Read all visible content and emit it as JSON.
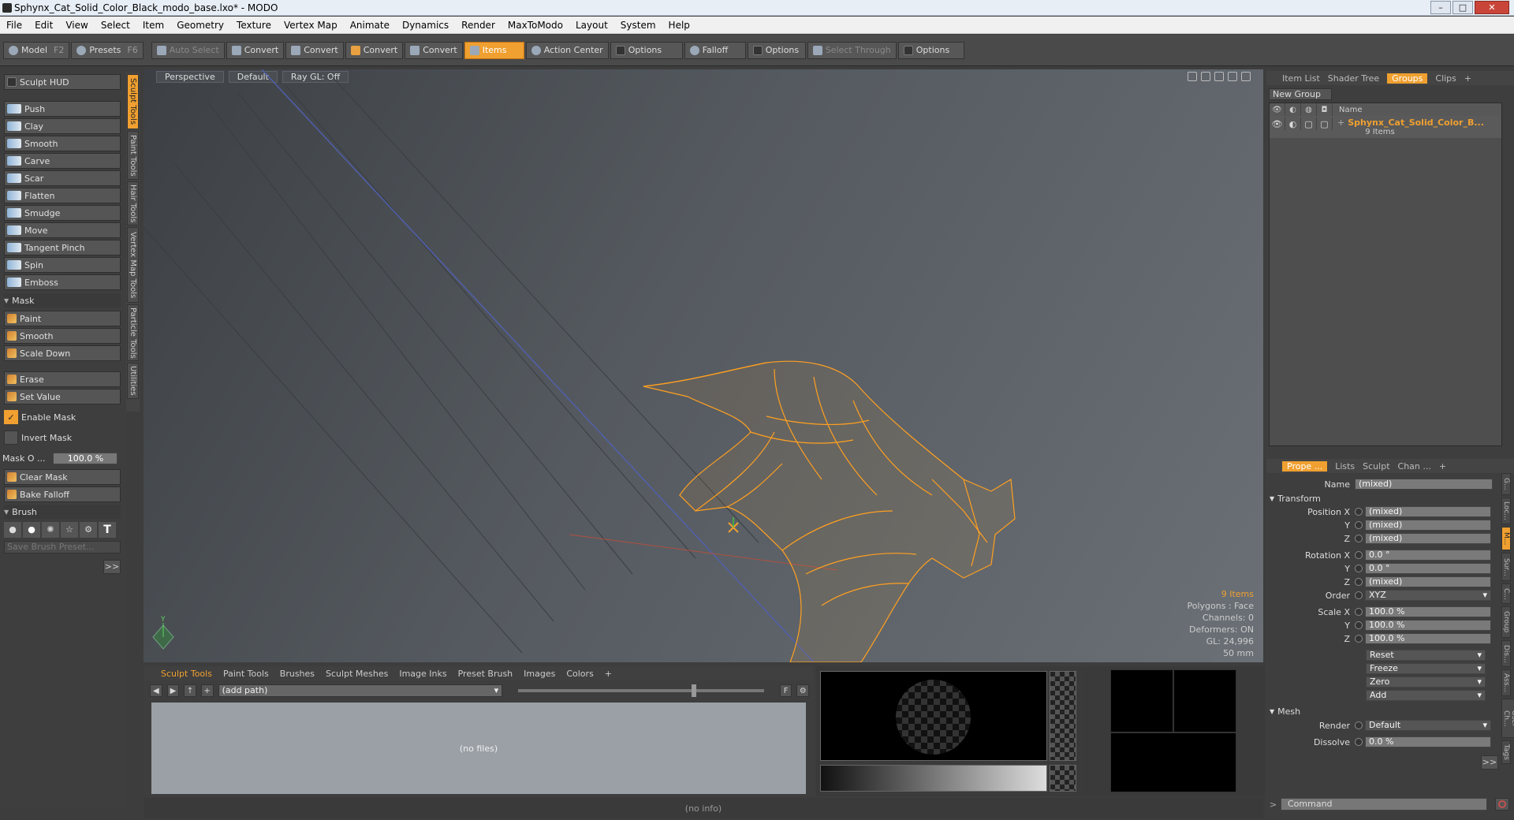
{
  "window": {
    "title": "Sphynx_Cat_Solid_Color_Black_modo_base.lxo* - MODO"
  },
  "menu": [
    "File",
    "Edit",
    "View",
    "Select",
    "Item",
    "Geometry",
    "Texture",
    "Vertex Map",
    "Animate",
    "Dynamics",
    "Render",
    "MaxToModo",
    "Layout",
    "System",
    "Help"
  ],
  "toolbar": {
    "model": "Model",
    "model_key": "F2",
    "presets": "Presets",
    "presets_key": "F6",
    "auto_select": "Auto Select",
    "convert": "Convert",
    "items": "Items",
    "action_center": "Action Center",
    "options": "Options",
    "falloff": "Falloff",
    "select_through": "Select Through"
  },
  "left": {
    "hud": "Sculpt HUD",
    "tools": [
      "Push",
      "Clay",
      "Smooth",
      "Carve",
      "Scar",
      "Flatten",
      "Smudge",
      "Move",
      "Tangent Pinch",
      "Spin",
      "Emboss"
    ],
    "mask_section": "Mask",
    "mask_tools": [
      "Paint",
      "Smooth",
      "Scale Down"
    ],
    "erase": "Erase",
    "set_value": "Set Value",
    "enable_mask": "Enable Mask",
    "invert_mask": "Invert Mask",
    "mask_opacity_label": "Mask O ...",
    "mask_opacity_value": "100.0 %",
    "clear_mask": "Clear Mask",
    "bake_falloff": "Bake Falloff",
    "brush_section": "Brush",
    "save_brush": "Save Brush Preset...",
    "more": ">>"
  },
  "vtabs": [
    "Sculpt Tools",
    "Paint Tools",
    "Hair Tools",
    "Vertex Map Tools",
    "Particle Tools",
    "Utilities"
  ],
  "viewport": {
    "tabs": [
      "Perspective",
      "Default",
      "Ray GL: Off"
    ],
    "stats": {
      "items": "9 Items",
      "polygons": "Polygons : Face",
      "channels": "Channels: 0",
      "deformers": "Deformers: ON",
      "gl": "GL: 24,996",
      "lens": "50 mm"
    }
  },
  "bottom": {
    "tabs": [
      "Sculpt Tools",
      "Paint Tools",
      "Brushes",
      "Sculpt Meshes",
      "Image Inks",
      "Preset Brush",
      "Images",
      "Colors"
    ],
    "path": "(add path)",
    "nofiles": "(no files)",
    "info": "(no info)",
    "f": "F"
  },
  "right": {
    "top_tabs": [
      "Item List",
      "Shader Tree",
      "Groups",
      "Clips"
    ],
    "new_group": "New Group",
    "col_name": "Name",
    "group_name": "Sphynx_Cat_Solid_Color_B...",
    "group_sub": "9 Items",
    "prop_tabs": [
      "Prope ...",
      "Lists",
      "Sculpt",
      "Chan ..."
    ],
    "name_label": "Name",
    "name_value": "(mixed)",
    "transform": "Transform",
    "position": [
      {
        "l": "Position X",
        "v": "(mixed)"
      },
      {
        "l": "Y",
        "v": "(mixed)"
      },
      {
        "l": "Z",
        "v": "(mixed)"
      }
    ],
    "rotation": [
      {
        "l": "Rotation X",
        "v": "0.0 °"
      },
      {
        "l": "Y",
        "v": "0.0 °"
      },
      {
        "l": "Z",
        "v": "(mixed)"
      }
    ],
    "order_label": "Order",
    "order_value": "XYZ",
    "scale": [
      {
        "l": "Scale X",
        "v": "100.0 %"
      },
      {
        "l": "Y",
        "v": "100.0 %"
      },
      {
        "l": "Z",
        "v": "100.0 %"
      }
    ],
    "actions": [
      "Reset",
      "Freeze",
      "Zero",
      "Add"
    ],
    "mesh": "Mesh",
    "render_label": "Render",
    "render_value": "Default",
    "dissolve_label": "Dissolve",
    "dissolve_value": "0.0 %",
    "more": ">>",
    "command": "Command",
    "side_tabs": [
      "G...",
      "Loc...",
      "M...",
      "Sur...",
      "C...",
      "Group",
      "Dis...",
      "Ass...",
      "User Ch...",
      "Tags"
    ]
  },
  "colors": {
    "accent": "#f0a030",
    "wire": "#ffa020"
  }
}
